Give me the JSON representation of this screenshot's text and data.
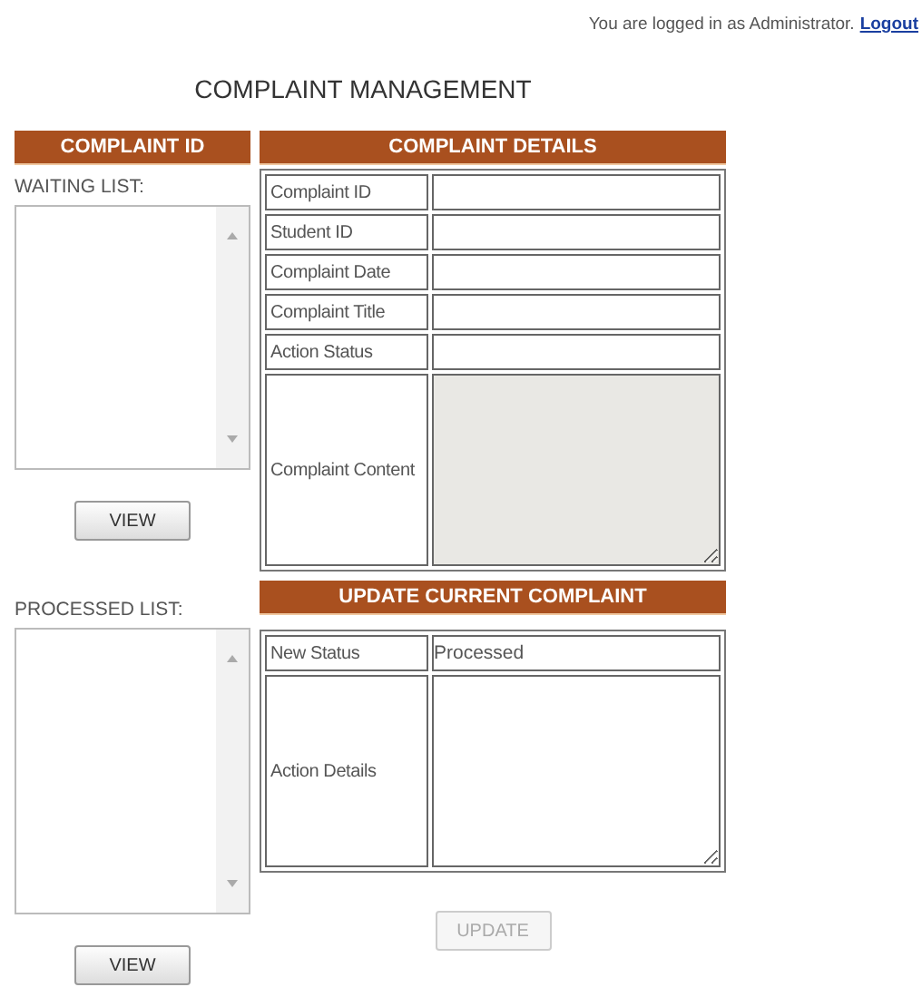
{
  "login": {
    "text": "You are logged in as Administrator.",
    "link": "Logout"
  },
  "title": "COMPLAINT MANAGEMENT",
  "left": {
    "header": "COMPLAINT ID",
    "lists": [
      {
        "label": "WAITING LIST:",
        "button": {
          "label": "VIEW",
          "disabled": false
        }
      },
      {
        "label": "PROCESSED LIST:",
        "button": {
          "label": "VIEW",
          "disabled": false
        }
      }
    ]
  },
  "details": {
    "header": "COMPLAINT DETAILS",
    "rows": [
      {
        "label": "Complaint ID",
        "kind": "input",
        "disabled": false
      },
      {
        "label": "Student ID",
        "kind": "input",
        "disabled": false
      },
      {
        "label": "Complaint Date",
        "kind": "input",
        "disabled": false
      },
      {
        "label": "Complaint Title",
        "kind": "input",
        "disabled": false
      },
      {
        "label": "Action Status",
        "kind": "input",
        "disabled": false
      },
      {
        "label": "Complaint Content",
        "kind": "textarea",
        "disabled": true
      }
    ]
  },
  "update": {
    "header": "UPDATE CURRENT COMPLAINT",
    "rows": [
      {
        "label": "New Status",
        "kind": "input",
        "value": "Processed",
        "disabled": false
      },
      {
        "label": "Action Details",
        "kind": "textarea",
        "disabled": false
      }
    ],
    "button": {
      "label": "UPDATE",
      "disabled": true
    }
  }
}
